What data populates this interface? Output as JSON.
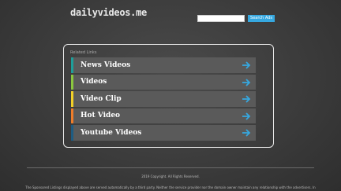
{
  "site": {
    "logo": "dailyvideos.me"
  },
  "search": {
    "placeholder": "",
    "button_label": "Search Ads"
  },
  "related": {
    "heading": "Related Links",
    "links": [
      {
        "label": "News Videos",
        "accent": "#1e9e9a"
      },
      {
        "label": "Videos",
        "accent": "#8bc63f"
      },
      {
        "label": "Video Clip",
        "accent": "#f2d028"
      },
      {
        "label": "Hot Video",
        "accent": "#ef7d2a"
      },
      {
        "label": "Youtube Videos",
        "accent": "#1e5c82"
      }
    ],
    "arrow_color": "#36a8e0",
    "arrow_icon": "arrow-right-icon"
  },
  "footer": {
    "copyright": "2019 Copyright. All Rights Reserved.",
    "disclaimer": "The Sponsored Listings displayed above are served automatically by a third party. Neither the service provider nor the domain owner maintain any relationship with the advertisers. In"
  }
}
